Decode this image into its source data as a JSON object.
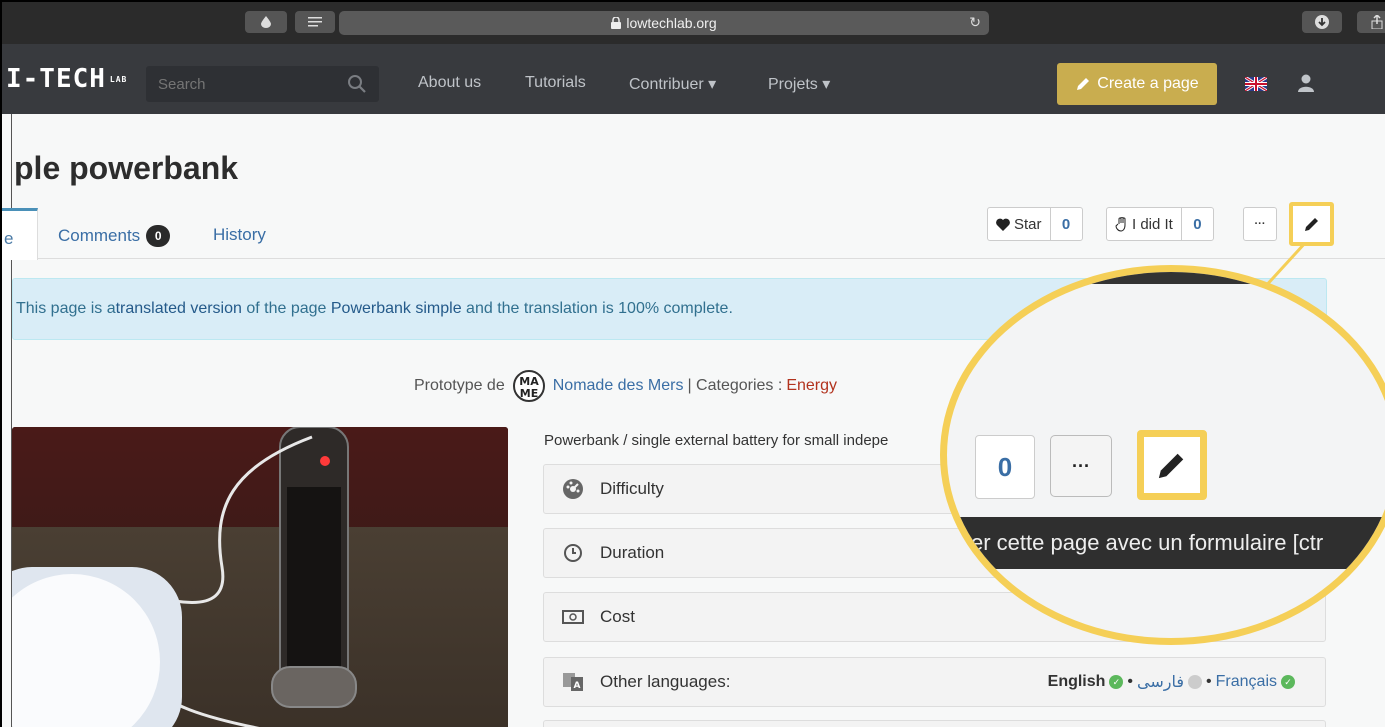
{
  "browser": {
    "url": "lowtechlab.org"
  },
  "navbar": {
    "logo": "I-TECH",
    "logo_sub": "LAB",
    "search_placeholder": "Search",
    "links": [
      "About us",
      "Tutorials",
      "Contribuer ▾",
      "Projets ▾"
    ],
    "create_label": "Create a page"
  },
  "page": {
    "title": "ple powerbank",
    "tabs": {
      "active": "e",
      "comments": "Comments",
      "comments_count": "0",
      "history": "History"
    },
    "actions": {
      "star_label": "Star",
      "star_count": "0",
      "did_label": "I did It",
      "did_count": "0",
      "more_label": "···"
    },
    "alert": {
      "prefix": "This page is a ",
      "link1": "translated version",
      "middle": " of the page ",
      "link2": "Powerbank simple",
      "suffix": " and the translation is 100% complete."
    },
    "prototype": {
      "label": "Prototype de",
      "author": "Nomade des Mers",
      "sep": "| Categories :",
      "category": "Energy"
    },
    "description": "Powerbank / single external battery for small indepe",
    "rows": {
      "difficulty": "Difficulty",
      "duration": "Duration",
      "cost": "Cost",
      "languages": "Other languages:"
    },
    "languages": {
      "english": "English",
      "farsi": "فارسی",
      "french": "Français",
      "bullet": "•"
    }
  },
  "zoom": {
    "count": "0",
    "more": "···",
    "tooltip": "er cette page avec un formulaire [ctr",
    "cost_suffix": "(€)"
  },
  "colors": {
    "accent_yellow": "#f5cf57",
    "create_button": "#c9ad4f",
    "navbar": "#383a3e",
    "link": "#3a6ea5",
    "category": "#b2331e"
  }
}
